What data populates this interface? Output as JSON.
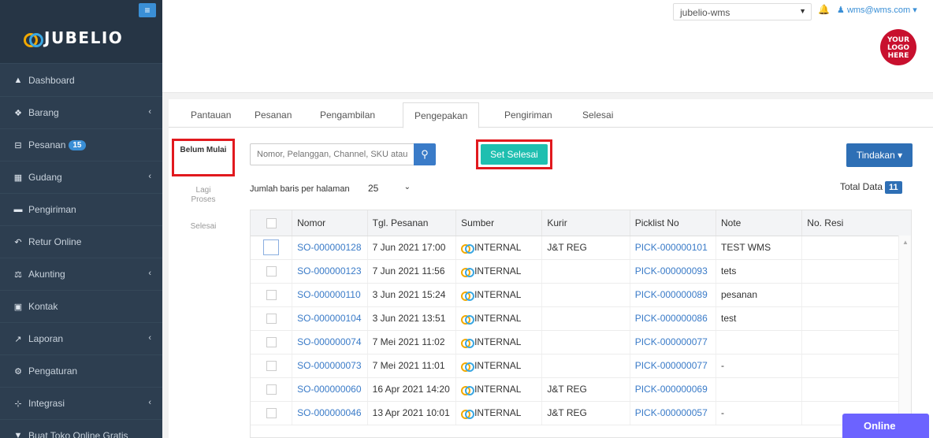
{
  "brand": {
    "name": "JUBELIO"
  },
  "sidebar": {
    "items": [
      {
        "label": "Dashboard",
        "icon": "chart-area-icon",
        "glyph": "▲"
      },
      {
        "label": "Barang",
        "icon": "cubes-icon",
        "glyph": "❖",
        "chevron": "‹"
      },
      {
        "label": "Pesanan",
        "icon": "cart-icon",
        "glyph": "⊟",
        "badge": "15"
      },
      {
        "label": "Gudang",
        "icon": "warehouse-icon",
        "glyph": "▦",
        "chevron": "‹"
      },
      {
        "label": "Pengiriman",
        "icon": "truck-icon",
        "glyph": "▬"
      },
      {
        "label": "Retur Online",
        "icon": "reply-icon",
        "glyph": "↶"
      },
      {
        "label": "Akunting",
        "icon": "scale-icon",
        "glyph": "⚖",
        "chevron": "‹"
      },
      {
        "label": "Kontak",
        "icon": "id-card-icon",
        "glyph": "▣"
      },
      {
        "label": "Laporan",
        "icon": "line-chart-icon",
        "glyph": "↗",
        "chevron": "‹"
      },
      {
        "label": "Pengaturan",
        "icon": "cogs-icon",
        "glyph": "⚙"
      },
      {
        "label": "Integrasi",
        "icon": "integration-icon",
        "glyph": "⊹",
        "chevron": "‹"
      },
      {
        "label": "Buat Toko Online Gratis",
        "icon": "store-icon",
        "glyph": "▼"
      }
    ]
  },
  "topbar": {
    "tenant": "jubelio-wms",
    "user": "wms@wms.com",
    "logo_lines": [
      "YOUR",
      "LOGO",
      "HERE"
    ]
  },
  "tabs": [
    "Pantauan",
    "Pesanan",
    "Pengambilan",
    "Pengepakan",
    "Pengiriman",
    "Selesai"
  ],
  "active_tab": "Pengepakan",
  "subnav": {
    "active": "Belum Mulai",
    "items": [
      "Lagi Proses",
      "Selesai"
    ]
  },
  "toolbar": {
    "search_placeholder": "Nomor, Pelanggan, Channel, SKU atau",
    "set_selesai": "Set Selesai",
    "tindakan": "Tindakan",
    "rows_label": "Jumlah baris per halaman",
    "rows_value": "25",
    "total_label": "Total Data",
    "total_value": "11"
  },
  "table": {
    "columns": [
      "Nomor",
      "Tgl. Pesanan",
      "Sumber",
      "Kurir",
      "Picklist No",
      "Note",
      "No. Resi"
    ],
    "rows": [
      [
        "SO-000000128",
        "7 Jun 2021 17:00",
        "INTERNAL",
        "J&T REG",
        "PICK-000000101",
        "TEST WMS",
        ""
      ],
      [
        "SO-000000123",
        "7 Jun 2021 11:56",
        "INTERNAL",
        "",
        "PICK-000000093",
        "tets",
        ""
      ],
      [
        "SO-000000110",
        "3 Jun 2021 15:24",
        "INTERNAL",
        "",
        "PICK-000000089",
        "pesanan",
        ""
      ],
      [
        "SO-000000104",
        "3 Jun 2021 13:51",
        "INTERNAL",
        "",
        "PICK-000000086",
        "test",
        ""
      ],
      [
        "SO-000000074",
        "7 Mei 2021 11:02",
        "INTERNAL",
        "",
        "PICK-000000077",
        "",
        ""
      ],
      [
        "SO-000000073",
        "7 Mei 2021 11:01",
        "INTERNAL",
        "",
        "PICK-000000077",
        "-",
        ""
      ],
      [
        "SO-000000060",
        "16 Apr 2021 14:20",
        "INTERNAL",
        "J&T REG",
        "PICK-000000069",
        "",
        ""
      ],
      [
        "SO-000000046",
        "13 Apr 2021 10:01",
        "INTERNAL",
        "J&T REG",
        "PICK-000000057",
        "-",
        ""
      ]
    ]
  },
  "chat": {
    "label": "Online"
  }
}
